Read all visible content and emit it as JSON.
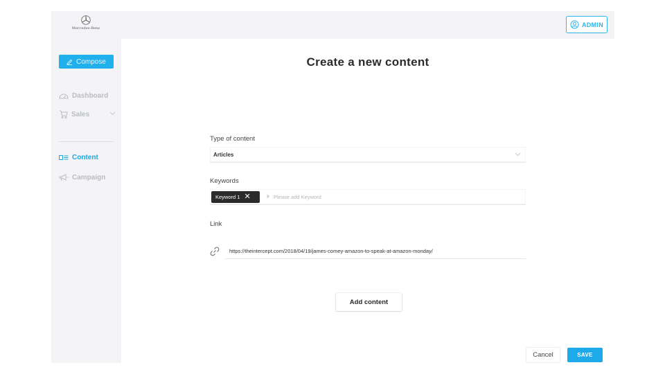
{
  "brand": {
    "name": "Mercedes-Benz"
  },
  "header": {
    "admin_label": "ADMIN"
  },
  "sidebar": {
    "compose_label": "Compose",
    "items": [
      {
        "label": "Dashboard",
        "icon": "gauge-icon",
        "active": false
      },
      {
        "label": "Sales",
        "icon": "cart-icon",
        "active": false,
        "has_submenu": true
      },
      {
        "label": "Content",
        "icon": "content-icon",
        "active": true
      },
      {
        "label": "Campaign",
        "icon": "megaphone-icon",
        "active": false
      }
    ]
  },
  "main": {
    "title": "Create a new content",
    "type_field": {
      "label": "Type of content",
      "value": "Articles"
    },
    "keywords_field": {
      "label": "Keywords",
      "chips": [
        "Keyword 1"
      ],
      "placeholder": "Please add Keyword"
    },
    "link_field": {
      "label": "Link",
      "value": "https://theintercept.com/2018/04/19/james-comey-amazon-to-speak-at-amazon-monday/"
    },
    "add_content_label": "Add content",
    "cancel_label": "Cancel",
    "save_label": "SAVE"
  },
  "colors": {
    "accent": "#20b0ec",
    "sidebar_bg": "#f4f4f6",
    "chip_bg": "#2b2b2b",
    "active_nav": "#1ba6e2"
  }
}
